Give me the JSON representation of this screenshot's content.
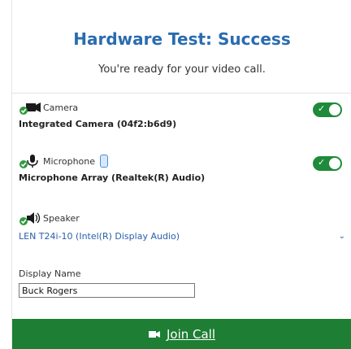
{
  "header": {
    "title": "Hardware Test: Success",
    "subtitle": "You're ready for your video call."
  },
  "camera": {
    "label": "Camera",
    "value": "Integrated Camera (04f2:b6d9)",
    "icon": "camera-icon",
    "enabled": true
  },
  "microphone": {
    "label": "Microphone",
    "value": "Microphone Array (Realtek(R) Audio)",
    "icon": "microphone-icon",
    "enabled": true
  },
  "speaker": {
    "label": "Speaker",
    "selected": "LEN T24i-10 (Intel(R) Display Audio)",
    "icon": "speaker-icon"
  },
  "display_name": {
    "label": "Display Name",
    "value": "Buck Rogers"
  },
  "join": {
    "label": "Join Call",
    "icon": "video-camera-icon"
  },
  "colors": {
    "title": "#2a6cb0",
    "toggle": "#1e8a3a",
    "join": "#1e7e34",
    "check": "#2e9b3e",
    "link": "#2a5ea8"
  }
}
